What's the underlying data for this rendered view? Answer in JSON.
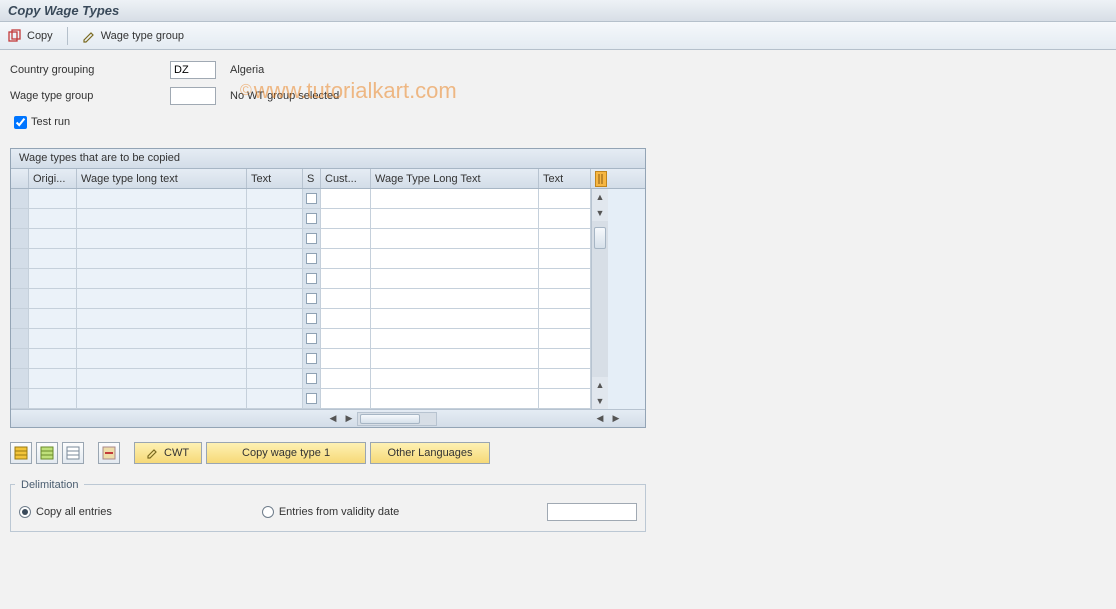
{
  "titlebar": "Copy Wage Types",
  "toolbar": {
    "copy": "Copy",
    "wtgroup": "Wage type group"
  },
  "fields": {
    "country_grouping_label": "Country grouping",
    "country_grouping_value": "DZ",
    "country_grouping_text": "Algeria",
    "wage_type_group_label": "Wage type group",
    "wage_type_group_value": "",
    "wage_type_group_text": "No WT group selected",
    "test_run_label": "Test run",
    "test_run_checked": true
  },
  "grid": {
    "title": "Wage types that are to be copied",
    "headers": {
      "h1": "Origi...",
      "h2": "Wage type long text",
      "h3": "Text",
      "h4": "S",
      "h5": "Cust...",
      "h6": "Wage Type Long Text",
      "h7": "Text"
    },
    "rows": 11
  },
  "buttons": {
    "cwt": "CWT",
    "copy_wt": "Copy wage type 1",
    "other_lang": "Other Languages"
  },
  "delimitation": {
    "title": "Delimitation",
    "opt_all": "Copy all entries",
    "opt_date": "Entries from validity date",
    "date_value": ""
  },
  "watermark": "www.tutorialkart.com"
}
